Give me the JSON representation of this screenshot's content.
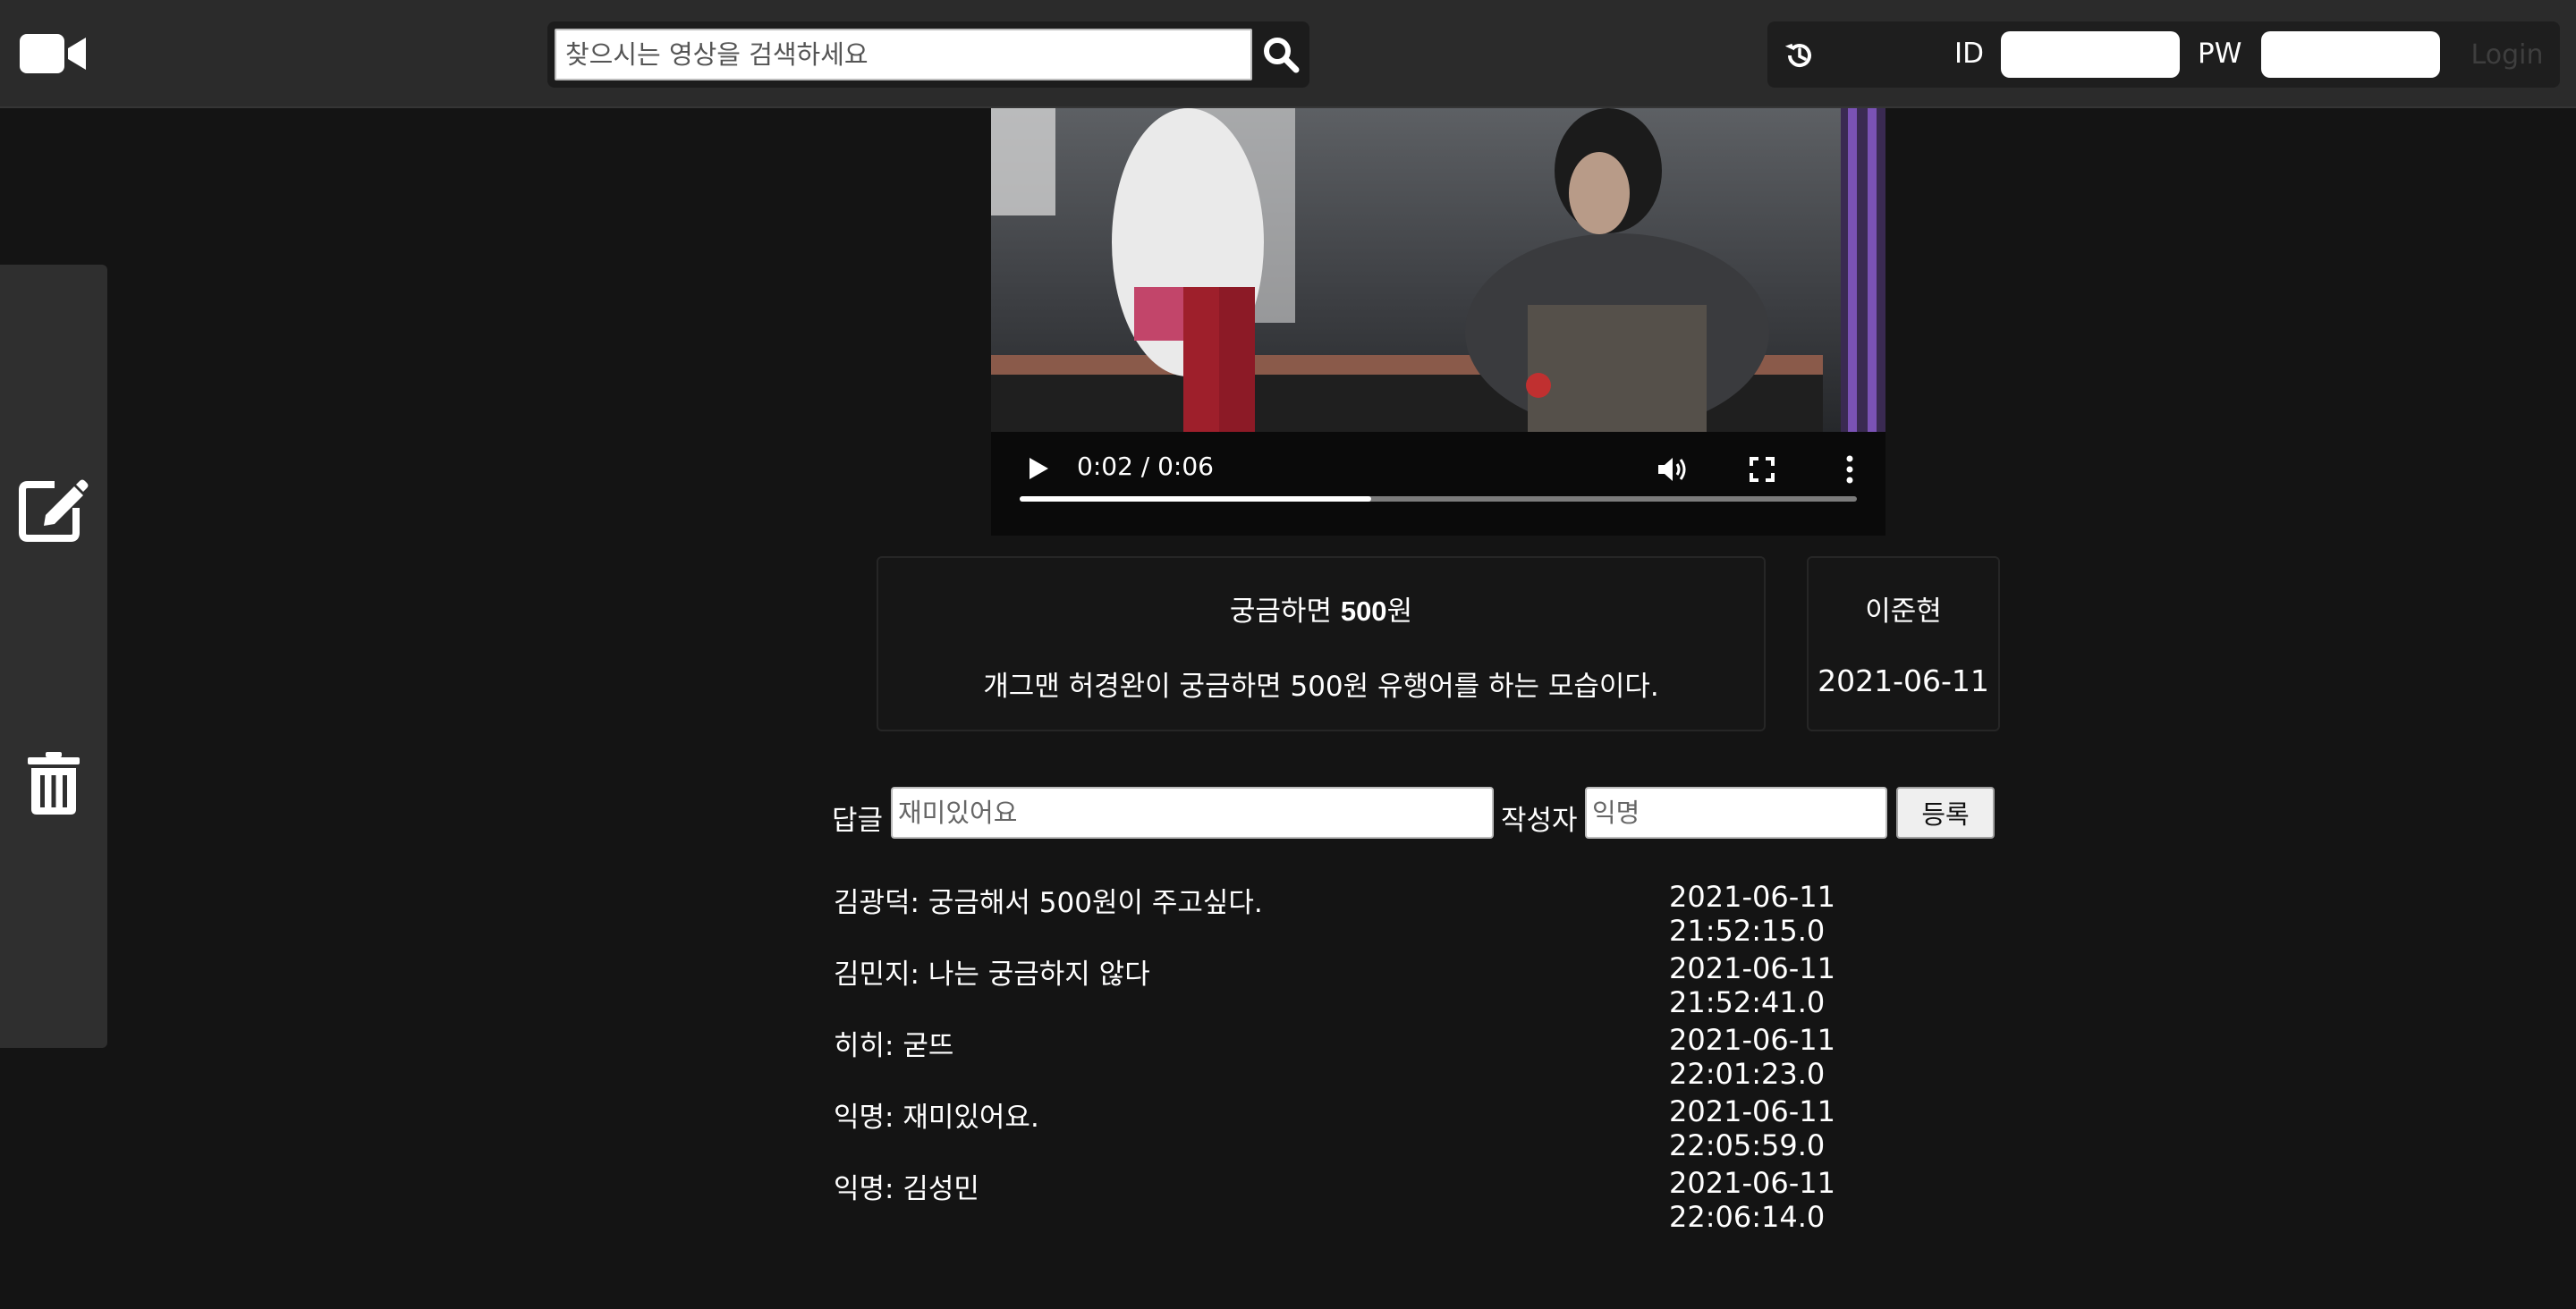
{
  "header": {
    "logo_icon": "video-camera-icon",
    "search": {
      "placeholder": "찾으시는 영상을 검색하세요",
      "value": ""
    },
    "search_icon": "search-icon",
    "history_icon": "history-icon",
    "id_label": "ID",
    "pw_label": "PW",
    "login_label": "Login"
  },
  "sidebar": {
    "items": [
      {
        "icon": "edit-icon"
      },
      {
        "icon": "trash-icon"
      }
    ]
  },
  "video": {
    "time": "0:02 / 0:06",
    "progress": 0.42,
    "controls": [
      "play-icon",
      "volume-icon",
      "fullscreen-icon",
      "more-icon"
    ]
  },
  "post": {
    "title_prefix": "궁금하면 ",
    "title_bold": "500",
    "title_suffix": "원",
    "description": "개그맨 허경완이 궁금하면 500원 유행어를 하는 모습이다.",
    "author": "이준현",
    "date": "2021-06-11"
  },
  "comment_form": {
    "reply_label": "답글",
    "reply_placeholder": "재미있어요",
    "writer_label": "작성자",
    "writer_placeholder": "익명",
    "submit_label": "등록"
  },
  "comments": [
    {
      "text": "김광덕: 궁금해서 500원이 주고싶다.",
      "time": "2021-06-11 21:52:15.0"
    },
    {
      "text": "김민지: 나는 궁금하지 않다",
      "time": "2021-06-11 21:52:41.0"
    },
    {
      "text": "히히: 굳뜨",
      "time": "2021-06-11 22:01:23.0"
    },
    {
      "text": "익명: 재미있어요.",
      "time": "2021-06-11 22:05:59.0"
    },
    {
      "text": "익명: 김성민",
      "time": "2021-06-11 22:06:14.0"
    }
  ],
  "colors": {
    "background": "#141414",
    "topbar": "#2b2b2b",
    "sidebar": "#2f2f2f"
  }
}
